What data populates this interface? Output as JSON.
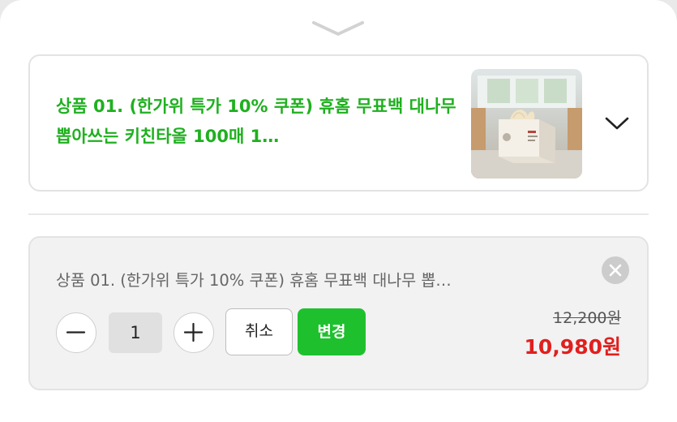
{
  "sheet": {
    "handle_icon": "chevron-down-icon"
  },
  "product": {
    "title": "상품 01. (한가위 특가 10% 쿠폰) 휴홈 무표백 대나무 뽑아쓰는 키친타올 100매 1…",
    "thumbnail": "kitchen-towel-box-image",
    "expand_icon": "chevron-down-icon",
    "title_color": "#1fb01f"
  },
  "option": {
    "title": "상품 01. (한가위 특가 10% 쿠폰) 휴홈 무표백 대나무 뽑…",
    "remove_icon": "close-icon",
    "decrease_label": "−",
    "quantity": "1",
    "increase_label": "+",
    "cancel_label": "취소",
    "change_label": "변경",
    "original_price": "12,200원",
    "sale_price": "10,980원",
    "accent_color": "#1ec12d",
    "sale_color": "#e0201e"
  }
}
